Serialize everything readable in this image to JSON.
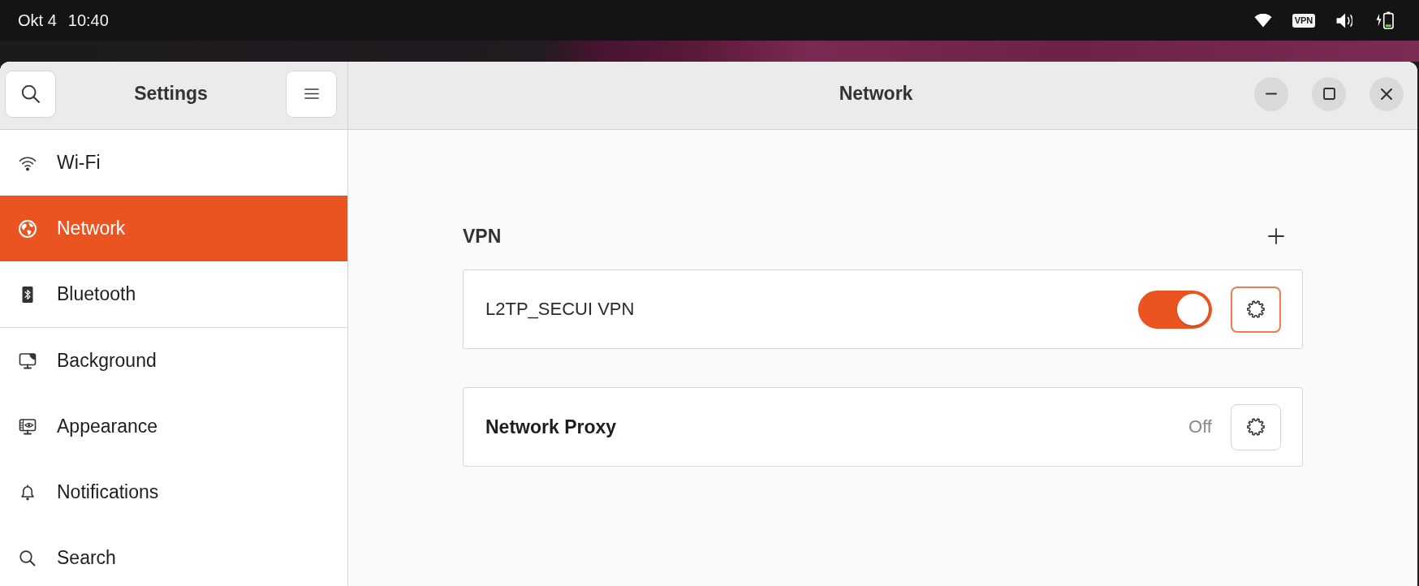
{
  "top_bar": {
    "date": "Okt 4",
    "time": "10:40",
    "vpn_badge": "VPN"
  },
  "sidebar": {
    "title": "Settings",
    "groups": [
      {
        "items": [
          {
            "label": "Wi-Fi",
            "selected": false
          },
          {
            "label": "Network",
            "selected": true
          },
          {
            "label": "Bluetooth",
            "selected": false
          }
        ]
      },
      {
        "items": [
          {
            "label": "Background",
            "selected": false
          },
          {
            "label": "Appearance",
            "selected": false
          },
          {
            "label": "Notifications",
            "selected": false
          },
          {
            "label": "Search",
            "selected": false
          }
        ]
      }
    ]
  },
  "content": {
    "title": "Network",
    "sections": [
      {
        "title": "VPN",
        "add_button": true,
        "rows": [
          {
            "kind": "toggle",
            "label": "L2TP_SECUI VPN",
            "on": true,
            "settings_focused": true
          }
        ]
      },
      {
        "rows": [
          {
            "kind": "status",
            "label": "Network Proxy",
            "status": "Off",
            "settings_focused": false
          }
        ]
      }
    ]
  }
}
